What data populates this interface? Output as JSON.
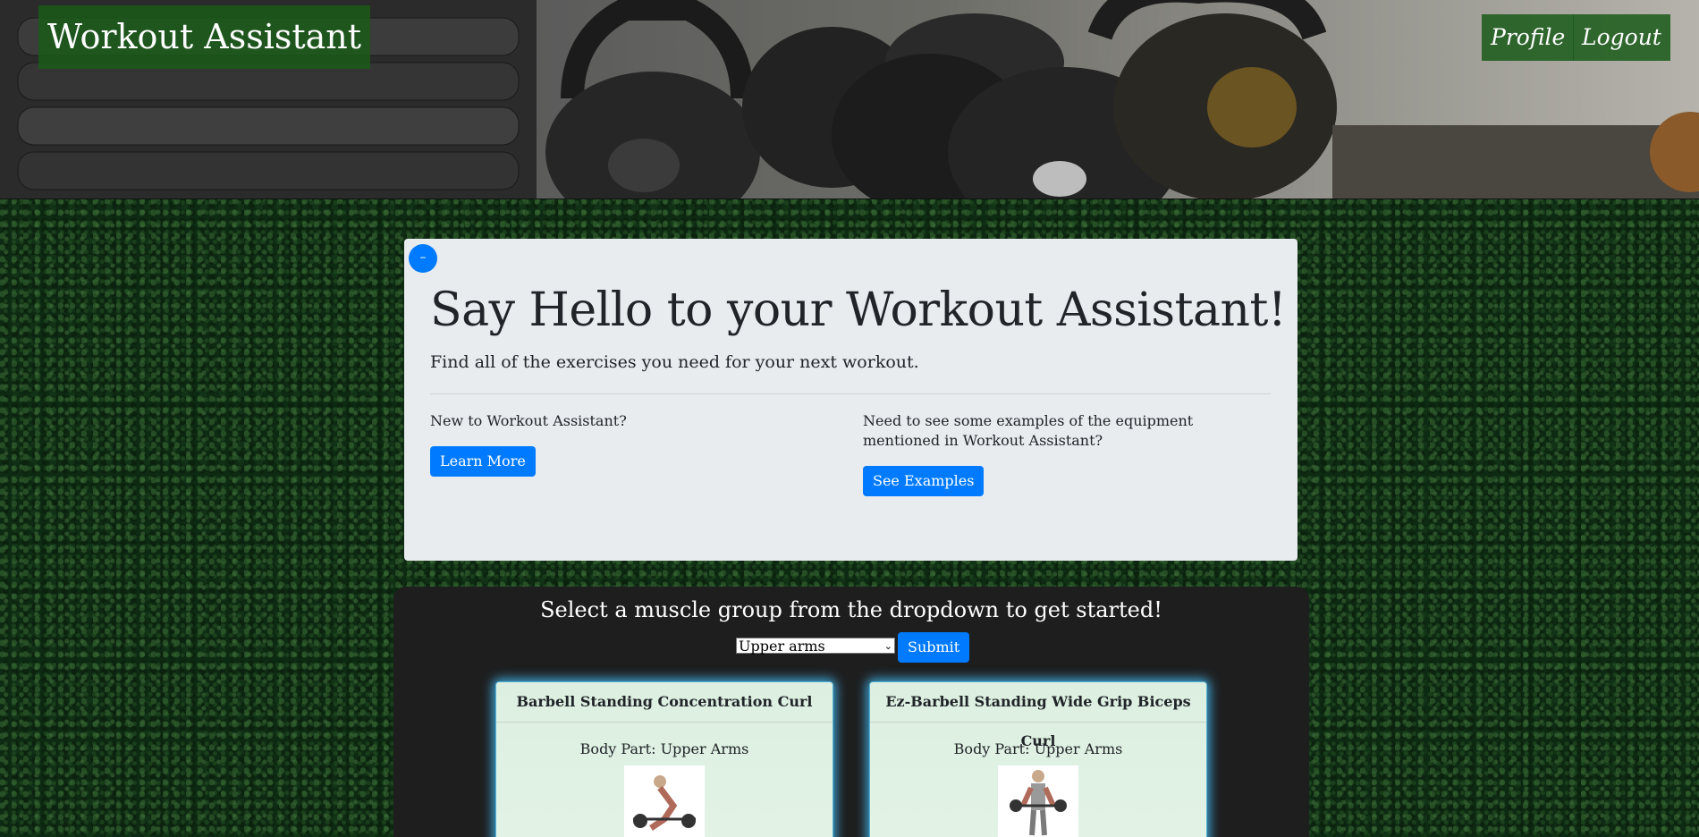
{
  "header": {
    "brand": "Workout Assistant",
    "nav": {
      "profile": "Profile",
      "logout": "Logout"
    }
  },
  "jumbotron": {
    "collapse_label": "–",
    "title": "Say Hello to your Workout Assistant!",
    "lead": "Find all of the exercises you need for your next workout.",
    "left": {
      "text": "New to Workout Assistant?",
      "button": "Learn More"
    },
    "right": {
      "text": "Need to see some examples of the equipment mentioned in Workout Assistant?",
      "button": "See Examples"
    }
  },
  "selector": {
    "heading": "Select a muscle group from the dropdown to get started!",
    "selected": "Upper arms",
    "submit": "Submit"
  },
  "cards": [
    {
      "title": "Barbell Standing Concentration Curl",
      "body_part": "Body Part: Upper Arms"
    },
    {
      "title": "Ez-Barbell Standing Wide Grip Biceps Curl",
      "body_part": "Body Part: Upper Arms"
    }
  ],
  "colors": {
    "accent_blue": "#007bff",
    "brand_green": "#195a19",
    "card_glow": "#3fa6d8"
  }
}
